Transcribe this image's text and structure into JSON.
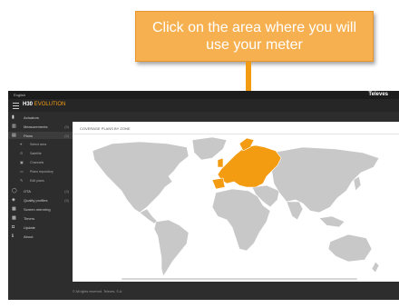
{
  "callout": {
    "text": "Click on the area where you will use your meter"
  },
  "topbar": {
    "language": "English",
    "brand": "Televes"
  },
  "logo": {
    "prefix": "H30",
    "suffix": "EVOLUTION"
  },
  "sidebar": {
    "items": [
      {
        "label": "Actuators",
        "icon": "meter-icon",
        "count": ""
      },
      {
        "label": "Measurements",
        "icon": "chart-icon",
        "count": "(5)"
      },
      {
        "label": "Plans",
        "icon": "plans-icon",
        "count": "(5)"
      },
      {
        "label": "Select area",
        "icon": "map-pin-icon",
        "count": "",
        "sub": true
      },
      {
        "label": "Satellite",
        "icon": "satellite-icon",
        "count": "",
        "sub": true
      },
      {
        "label": "Channels",
        "icon": "tv-icon",
        "count": "",
        "sub": true
      },
      {
        "label": "Plans repository",
        "icon": "folder-icon",
        "count": "",
        "sub": true
      },
      {
        "label": "Edit plans",
        "icon": "edit-icon",
        "count": "",
        "sub": true
      },
      {
        "label": "OTA",
        "icon": "chat-icon",
        "count": "(4)"
      },
      {
        "label": "Quality profiles",
        "icon": "quality-icon",
        "count": "(5)"
      },
      {
        "label": "Screen mirroring",
        "icon": "screen-icon",
        "count": ""
      },
      {
        "label": "Timers",
        "icon": "timer-icon",
        "count": ""
      },
      {
        "label": "Update",
        "icon": "camera-icon",
        "count": ""
      },
      {
        "label": "About",
        "icon": "info-icon",
        "count": ""
      }
    ]
  },
  "main": {
    "title": "COVERAGE PLANS BY ZONE"
  },
  "footer": {
    "text": "© All rights reserved. Televes, S.A."
  },
  "colors": {
    "highlight": "#f39c12",
    "land": "#c8c8c8"
  }
}
